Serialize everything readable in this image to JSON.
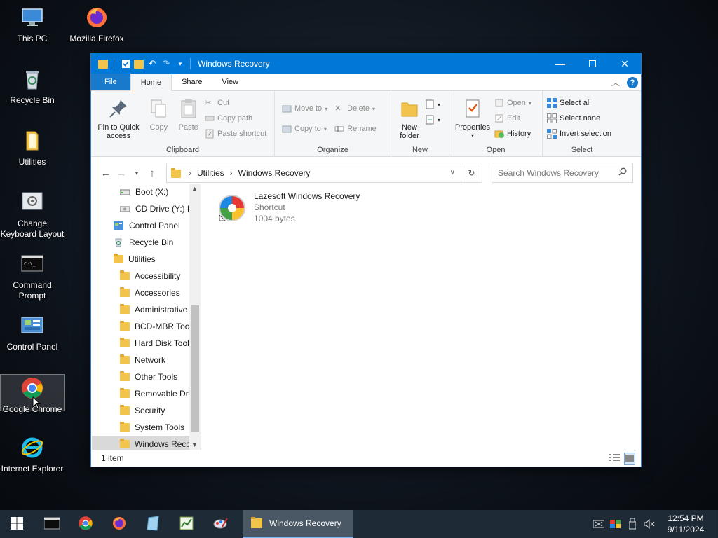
{
  "desktop": {
    "icons": [
      {
        "label": "This PC",
        "icon": "computer-icon"
      },
      {
        "label": "Mozilla Firefox",
        "icon": "firefox-icon"
      },
      {
        "label": "Recycle Bin",
        "icon": "recycle-bin-icon"
      },
      {
        "label": "Utilities",
        "icon": "folder-icon"
      },
      {
        "label": "Change Keyboard Layout",
        "icon": "keyboard-layout-icon"
      },
      {
        "label": "Command Prompt",
        "icon": "command-prompt-icon"
      },
      {
        "label": "Control Panel",
        "icon": "control-panel-icon"
      },
      {
        "label": "Google Chrome",
        "icon": "chrome-icon"
      },
      {
        "label": "Internet Explorer",
        "icon": "internet-explorer-icon"
      }
    ]
  },
  "window": {
    "title": "Windows Recovery",
    "tabs": {
      "file": "File",
      "home": "Home",
      "share": "Share",
      "view": "View"
    },
    "ribbon": {
      "clipboard": {
        "label": "Clipboard",
        "pin": "Pin to Quick access",
        "copy": "Copy",
        "paste": "Paste",
        "cut": "Cut",
        "copy_path": "Copy path",
        "paste_shortcut": "Paste shortcut"
      },
      "organize": {
        "label": "Organize",
        "move_to": "Move to",
        "copy_to": "Copy to",
        "delete": "Delete",
        "rename": "Rename"
      },
      "new": {
        "label": "New",
        "new_folder": "New folder"
      },
      "open": {
        "label": "Open",
        "properties": "Properties",
        "open": "Open",
        "edit": "Edit",
        "history": "History"
      },
      "select": {
        "label": "Select",
        "select_all": "Select all",
        "select_none": "Select none",
        "invert": "Invert selection"
      }
    },
    "address": {
      "path": [
        "Utilities",
        "Windows Recovery"
      ],
      "search_placeholder": "Search Windows Recovery"
    },
    "nav_pane": [
      {
        "label": "Boot (X:)",
        "icon": "drive-icon",
        "indent": 2
      },
      {
        "label": "CD Drive (Y:) H",
        "icon": "cd-drive-icon",
        "indent": 2
      },
      {
        "label": "Control Panel",
        "icon": "control-panel-icon",
        "indent": 1
      },
      {
        "label": "Recycle Bin",
        "icon": "recycle-bin-icon",
        "indent": 1
      },
      {
        "label": "Utilities",
        "icon": "folder-icon",
        "indent": 1
      },
      {
        "label": "Accessibility",
        "icon": "folder-icon",
        "indent": 2
      },
      {
        "label": "Accessories",
        "icon": "folder-icon",
        "indent": 2
      },
      {
        "label": "Administrative",
        "icon": "folder-icon",
        "indent": 2
      },
      {
        "label": "BCD-MBR Tool",
        "icon": "folder-icon",
        "indent": 2
      },
      {
        "label": "Hard Disk Tools",
        "icon": "folder-icon",
        "indent": 2
      },
      {
        "label": "Network",
        "icon": "folder-icon",
        "indent": 2
      },
      {
        "label": "Other Tools",
        "icon": "folder-icon",
        "indent": 2
      },
      {
        "label": "Removable Dri",
        "icon": "folder-icon",
        "indent": 2
      },
      {
        "label": "Security",
        "icon": "folder-icon",
        "indent": 2
      },
      {
        "label": "System Tools",
        "icon": "folder-icon",
        "indent": 2
      },
      {
        "label": "Windows Reco",
        "icon": "folder-icon",
        "indent": 2,
        "selected": true
      }
    ],
    "files": [
      {
        "name": "Lazesoft Windows Recovery",
        "type": "Shortcut",
        "size": "1004 bytes"
      }
    ],
    "status": "1 item"
  },
  "taskbar": {
    "active_app": "Windows Recovery",
    "time": "12:54 PM",
    "date": "9/11/2024"
  },
  "colors": {
    "accent": "#0078d7",
    "folder": "#f3c44c",
    "taskbar": "#1e2a36"
  }
}
